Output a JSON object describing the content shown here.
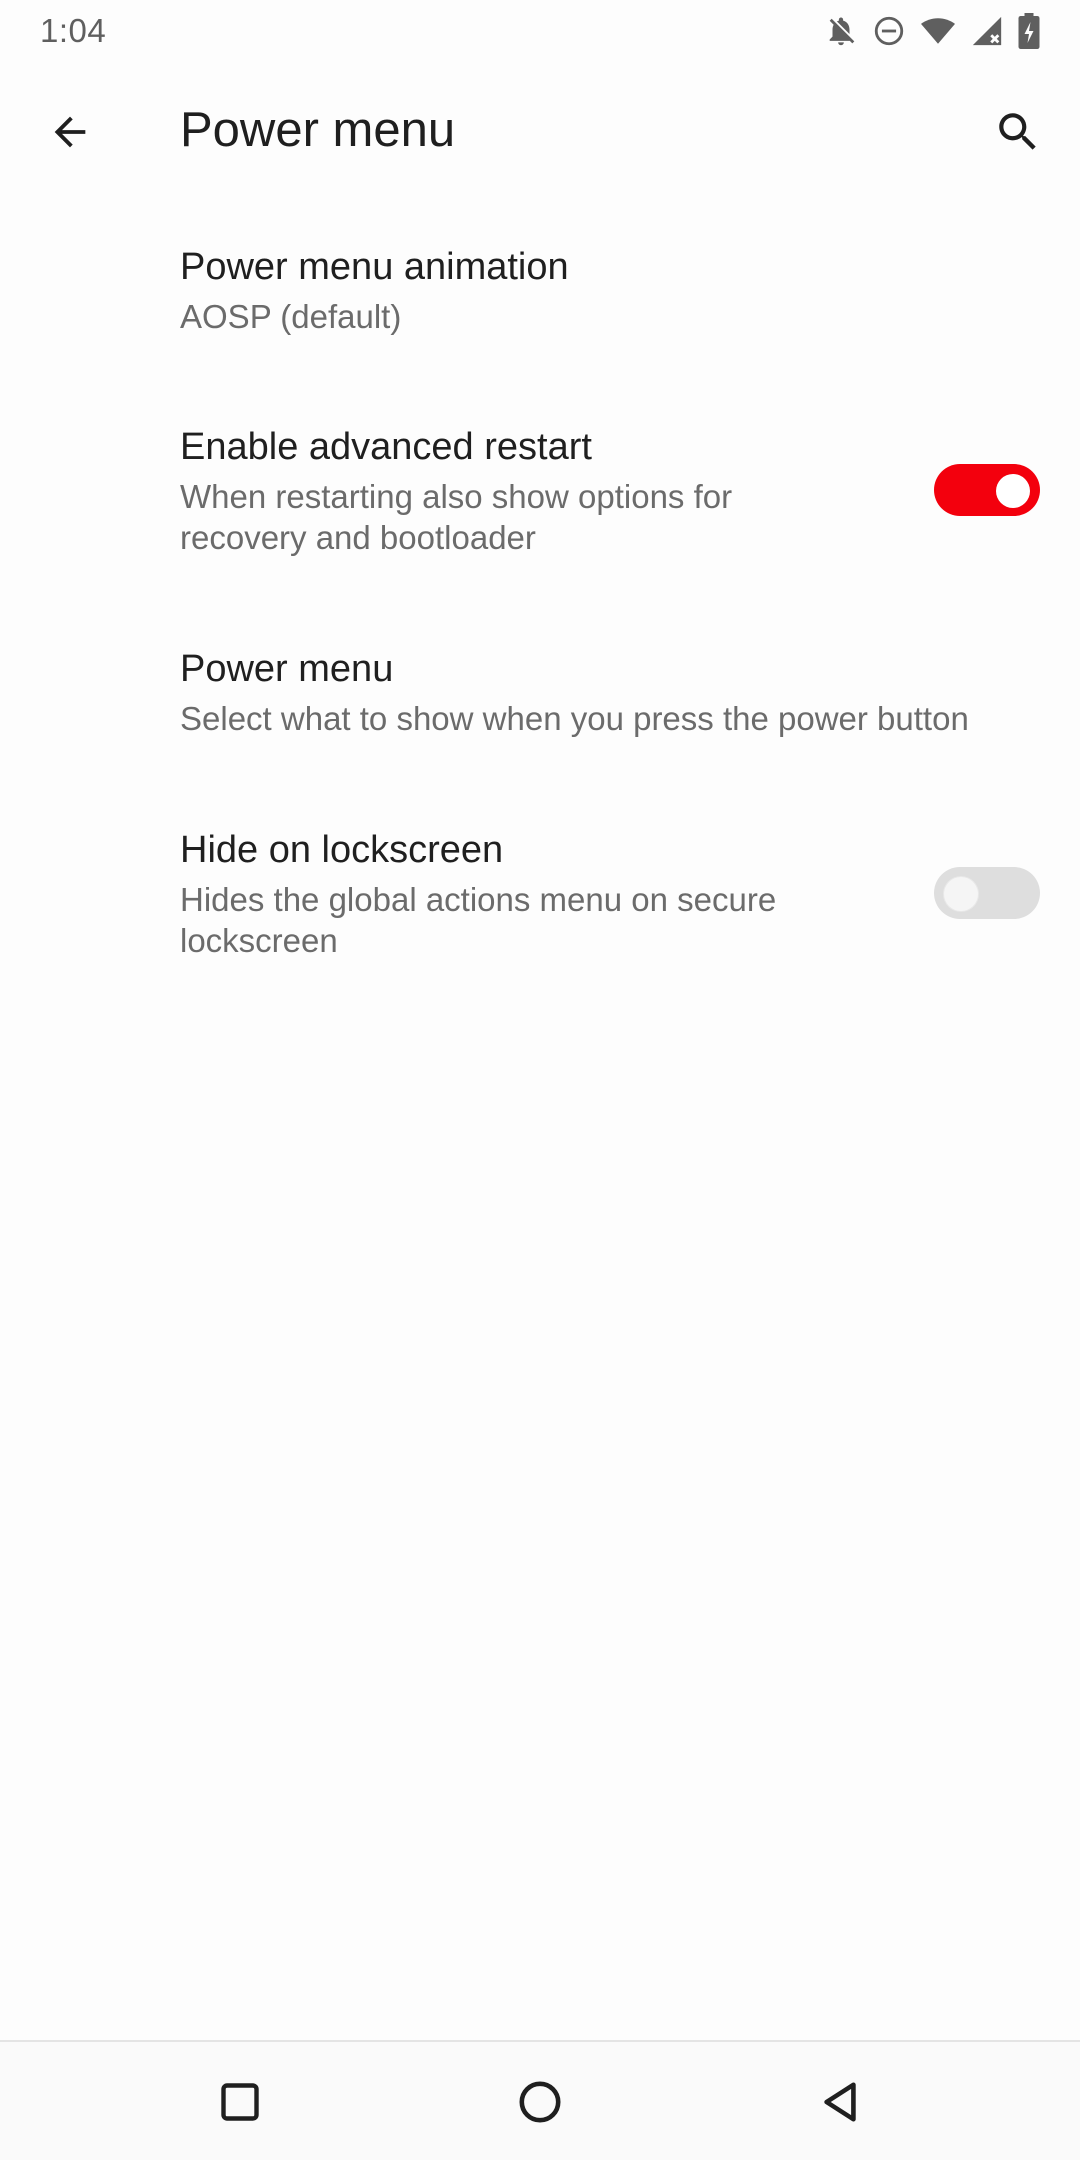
{
  "status_bar": {
    "time": "1:04",
    "icons": [
      "notifications-off-icon",
      "do-not-disturb-icon",
      "wifi-icon",
      "signal-icon",
      "battery-charging-icon"
    ]
  },
  "app_bar": {
    "title": "Power menu",
    "back_icon": "arrow-back-icon",
    "search_icon": "search-icon"
  },
  "preferences": [
    {
      "title": "Power menu animation",
      "summary": "AOSP (default)"
    },
    {
      "title": "Enable advanced restart",
      "summary_line1": "When restarting also show options for",
      "summary_line2": "recovery and bootloader",
      "switch_on": true
    },
    {
      "title": "Power menu",
      "summary": "Select what to show when you press the power button"
    },
    {
      "title": "Hide on lockscreen",
      "summary_line1": "Hides the global actions menu on secure",
      "summary_line2": "lockscreen",
      "switch_on": false
    }
  ],
  "colors": {
    "accent": "#f3000d",
    "switch_off_track": "#dedede",
    "summary_text": "#6b6b6b"
  },
  "nav_bar": {
    "icons": [
      "recents-icon",
      "home-icon",
      "back-triangle-icon"
    ]
  }
}
